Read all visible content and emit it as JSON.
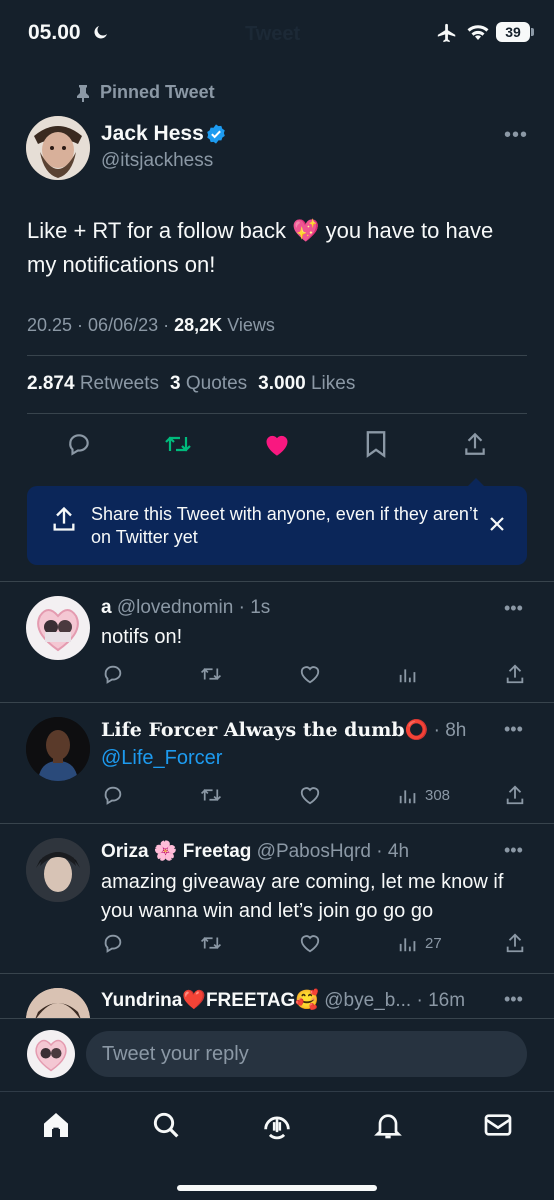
{
  "status_bar": {
    "time": "05.00",
    "battery": "39"
  },
  "header": {
    "title": "Tweet"
  },
  "pinned": {
    "label": "Pinned Tweet"
  },
  "tweet": {
    "author_name": "Jack Hess",
    "author_handle": "@itsjackhess",
    "text": "Like + RT for a follow back 💖 you have to have my notifications on!",
    "time": "20.25",
    "date": "06/06/23",
    "views_count": "28,2K",
    "views_label": "Views",
    "retweets_count": "2.874",
    "retweets_label": "Retweets",
    "quotes_count": "3",
    "quotes_label": "Quotes",
    "likes_count": "3.000",
    "likes_label": "Likes"
  },
  "share_banner": {
    "text": "Share this Tweet with anyone, even if they aren’t on Twitter yet"
  },
  "replies": [
    {
      "name": "a",
      "handle": "@lovednomin",
      "time": "1s",
      "text": "notifs on!",
      "views": ""
    },
    {
      "name": "Life Forcer Always the dumb⭕",
      "handle": "",
      "time": "8h",
      "text": "@Life_Forcer",
      "views": "308"
    },
    {
      "name": "Oriza 🌸 Freetag",
      "handle": "@PabosHqrd",
      "time": "4h",
      "text": "amazing giveaway are coming, let me know if you wanna win and let’s join go go go",
      "views": "27"
    },
    {
      "name": "Yundrina❤️FREETAG🥰",
      "handle": "@bye_b...",
      "time": "16m",
      "text": "",
      "views": ""
    }
  ],
  "reply_bar": {
    "placeholder": "Tweet your reply"
  },
  "colors": {
    "background": "#15202b",
    "banner": "#0b2659",
    "accent": "#1d9bf0",
    "like": "#f91880",
    "retweet": "#00ba7c"
  }
}
